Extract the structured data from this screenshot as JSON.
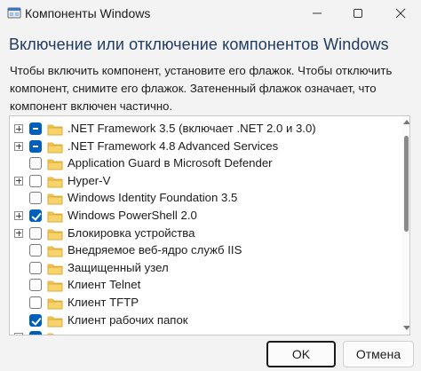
{
  "window": {
    "title": "Компоненты Windows",
    "minimize_icon": "minimize-icon",
    "maximize_icon": "maximize-icon",
    "close_icon": "close-icon"
  },
  "heading": "Включение или отключение компонентов Windows",
  "description": "Чтобы включить компонент, установите его флажок. Чтобы отключить компонент, снимите его флажок. Затененный флажок означает, что компонент включен частично.",
  "features": [
    {
      "label": ".NET Framework 3.5 (включает .NET 2.0 и 3.0)",
      "state": "partial",
      "expandable": true
    },
    {
      "label": ".NET Framework 4.8 Advanced Services",
      "state": "partial",
      "expandable": true
    },
    {
      "label": "Application Guard в Microsoft Defender",
      "state": "unchecked",
      "expandable": false
    },
    {
      "label": "Hyper-V",
      "state": "unchecked",
      "expandable": true
    },
    {
      "label": "Windows Identity Foundation 3.5",
      "state": "unchecked",
      "expandable": false
    },
    {
      "label": "Windows PowerShell 2.0",
      "state": "checked",
      "expandable": true
    },
    {
      "label": "Блокировка устройства",
      "state": "unchecked",
      "expandable": true
    },
    {
      "label": "Внедряемое веб-ядро служб IIS",
      "state": "unchecked",
      "expandable": false
    },
    {
      "label": "Защищенный узел",
      "state": "unchecked",
      "expandable": false
    },
    {
      "label": "Клиент Telnet",
      "state": "unchecked",
      "expandable": false
    },
    {
      "label": "Клиент TFTP",
      "state": "unchecked",
      "expandable": false
    },
    {
      "label": "Клиент рабочих папок",
      "state": "checked",
      "expandable": false
    },
    {
      "label": "",
      "state": "partial",
      "expandable": true
    }
  ],
  "buttons": {
    "ok": "OK",
    "cancel": "Отмена"
  },
  "colors": {
    "accent": "#005fb8",
    "folder": "#f4c64f",
    "heading": "#1f3a5f"
  }
}
